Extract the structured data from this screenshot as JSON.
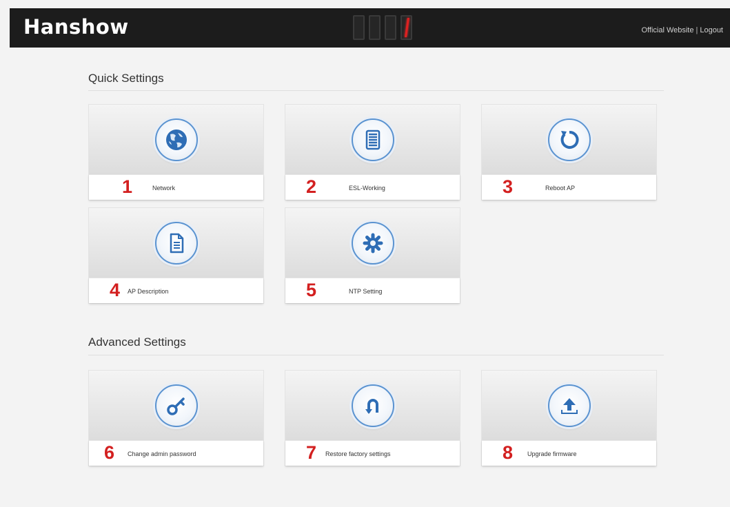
{
  "header": {
    "brand": "Hanshow",
    "links": [
      "Official Website",
      "Logout"
    ],
    "separator": "|"
  },
  "sections": [
    {
      "title": "Quick Settings",
      "tiles": [
        {
          "number": "1",
          "label": "Network",
          "icon": "globe-icon"
        },
        {
          "number": "2",
          "label": "ESL-Working",
          "icon": "list-icon"
        },
        {
          "number": "3",
          "label": "Reboot AP",
          "icon": "refresh-icon"
        },
        {
          "number": "4",
          "label": "AP Description",
          "icon": "document-icon"
        },
        {
          "number": "5",
          "label": "NTP Setting",
          "icon": "gear-icon"
        }
      ]
    },
    {
      "title": "Advanced Settings",
      "tiles": [
        {
          "number": "6",
          "label": "Change admin password",
          "icon": "key-icon"
        },
        {
          "number": "7",
          "label": "Restore factory settings",
          "icon": "u-turn-icon"
        },
        {
          "number": "8",
          "label": "Upgrade firmware",
          "icon": "upload-icon"
        }
      ]
    }
  ],
  "colors": {
    "accent": "#2e6db5",
    "number": "#d32020",
    "topbar": "#1c1c1c"
  }
}
